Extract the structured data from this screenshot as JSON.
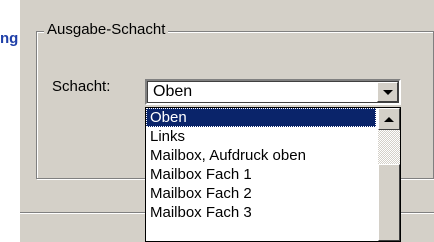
{
  "left_label": "ng",
  "group": {
    "title": "Ausgabe-Schacht"
  },
  "schacht": {
    "label": "Schacht:",
    "selected_value": "Oben",
    "options": [
      {
        "label": "Oben",
        "selected": true
      },
      {
        "label": "Links",
        "selected": false
      },
      {
        "label": "Mailbox, Aufdruck oben",
        "selected": false
      },
      {
        "label": "Mailbox Fach 1",
        "selected": false
      },
      {
        "label": "Mailbox Fach 2",
        "selected": false
      },
      {
        "label": "Mailbox Fach 3",
        "selected": false
      }
    ]
  },
  "icons": {
    "dropdown_arrow": "chevron-down-icon",
    "scroll_up": "scroll-up-arrow-icon"
  },
  "colors": {
    "selection_bg": "#0a246a",
    "dialog_bg": "#d4d0c8",
    "label_blue": "#1f3fa8"
  }
}
